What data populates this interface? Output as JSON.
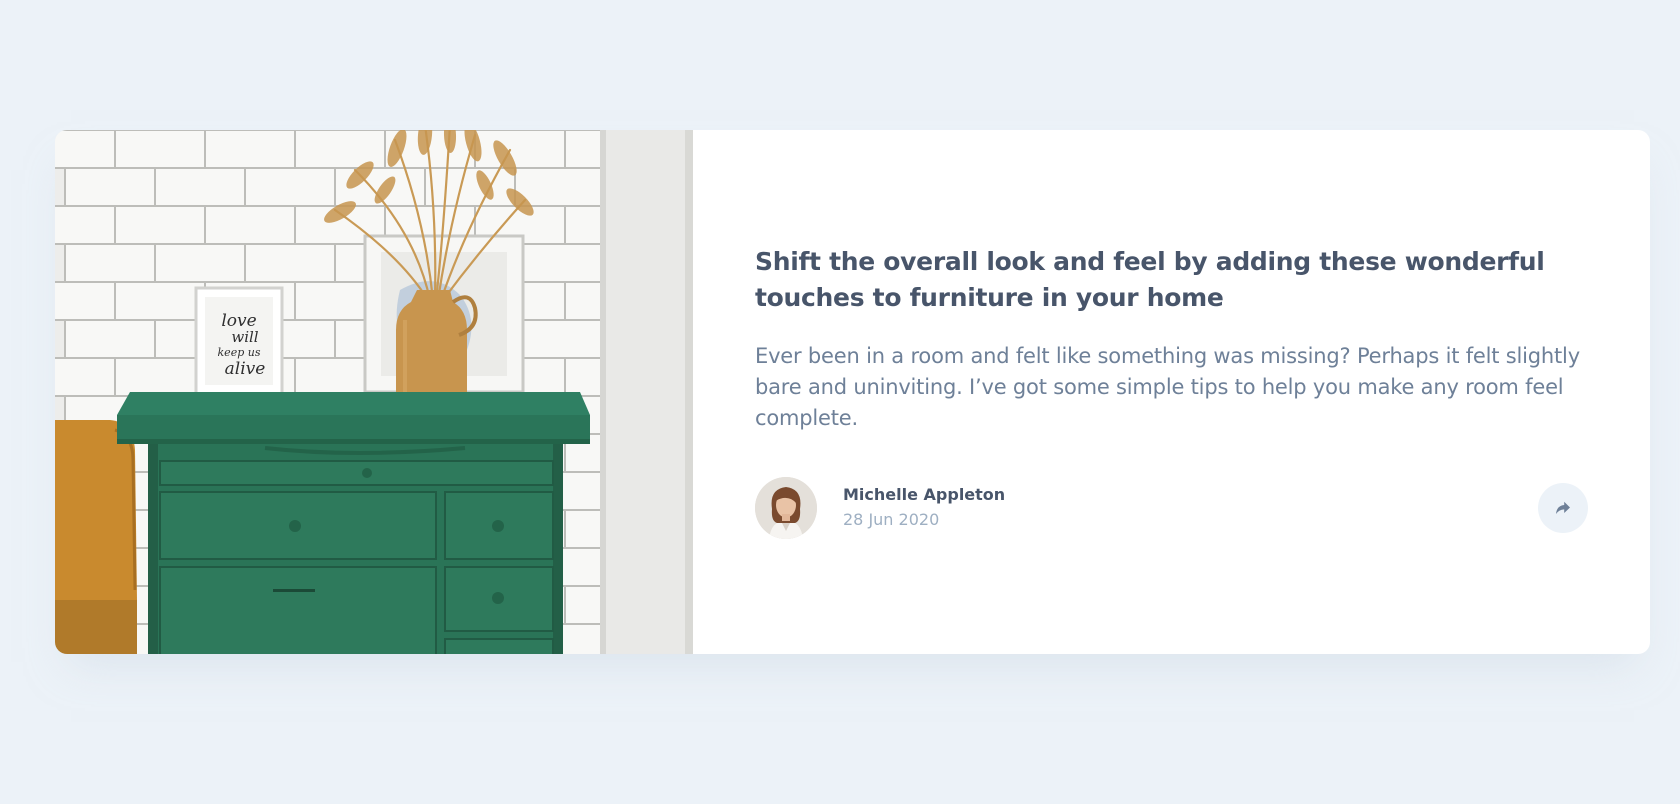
{
  "article": {
    "title": "Shift the overall look and feel by adding these wonderful touches to furniture in your home",
    "description": "Ever been in a room and felt like something was missing? Perhaps it felt slightly bare and uninviting. I’ve got some simple tips to help you make any room feel complete.",
    "frame_text": [
      "love",
      "will",
      "keep us",
      "alive"
    ]
  },
  "author": {
    "name": "Michelle Appleton",
    "date": "28 Jun 2020"
  },
  "share": {
    "icon": "share-icon"
  },
  "colors": {
    "background": "#ECF2F8",
    "card": "#FFFFFF",
    "title": "#48556A",
    "body": "#6E8098",
    "muted": "#9EAFC2",
    "drawer_green": "#2E7A5C"
  }
}
